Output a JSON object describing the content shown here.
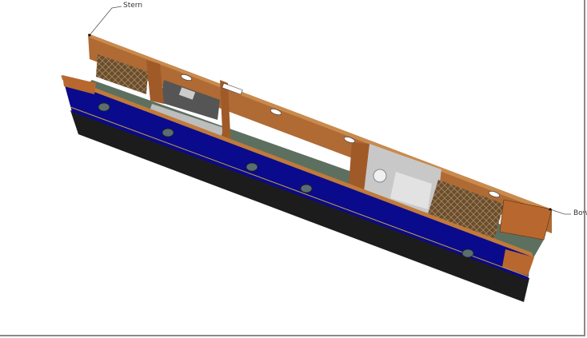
{
  "labels": {
    "stern": "Stern",
    "bow": "Bow"
  },
  "colors": {
    "hull": "#0a0a8c",
    "base": "#1a1a1a",
    "timber": "#b8682e",
    "floor": "#5d7060",
    "mattress": "#6a4d2e",
    "bathroom": "#c8c8c8"
  }
}
